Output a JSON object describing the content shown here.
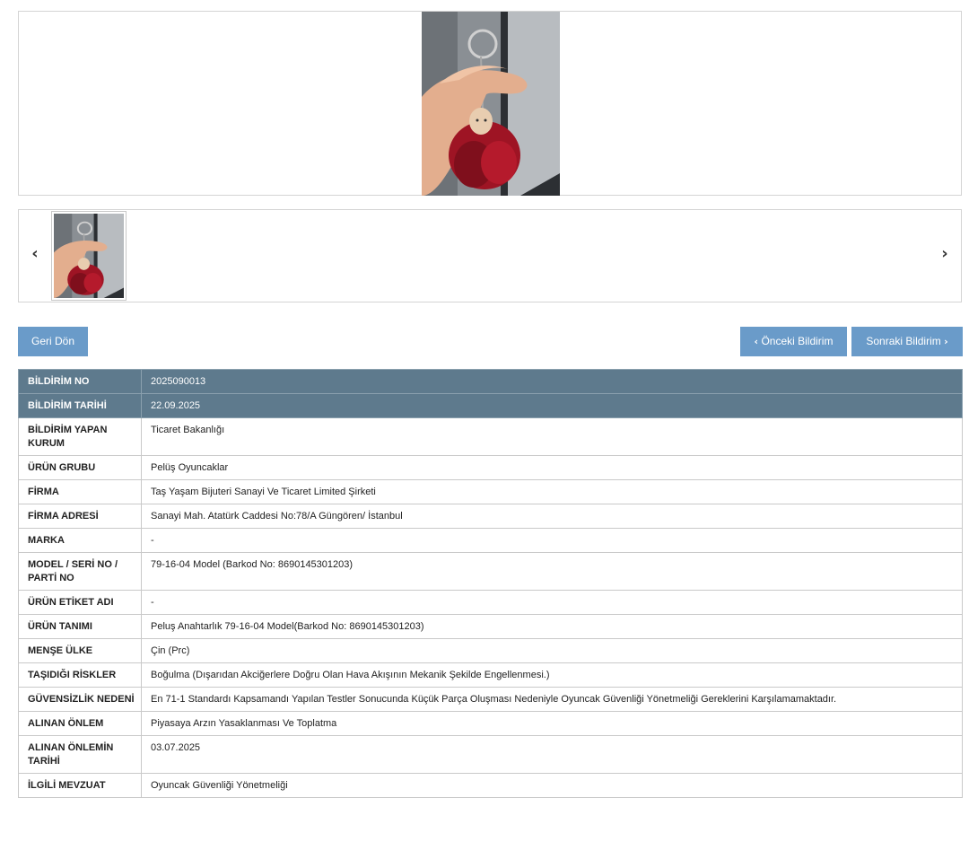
{
  "gallery": {
    "prev_arrow": "‹",
    "next_arrow": "›"
  },
  "buttons": {
    "back": "Geri Dön",
    "prev": "Önceki Bildirim",
    "next": "Sonraki Bildirim",
    "prev_chevron": "‹",
    "next_chevron": "›"
  },
  "details": [
    {
      "key": "BİLDİRİM NO",
      "value": "2025090013",
      "highlight": true
    },
    {
      "key": "BİLDİRİM TARİHİ",
      "value": "22.09.2025",
      "highlight": true
    },
    {
      "key": "BİLDİRİM YAPAN KURUM",
      "value": "Ticaret Bakanlığı"
    },
    {
      "key": "ÜRÜN GRUBU",
      "value": "Pelüş Oyuncaklar"
    },
    {
      "key": "FİRMA",
      "value": "Taş Yaşam Bijuteri Sanayi Ve Ticaret Limited Şirketi"
    },
    {
      "key": "FİRMA ADRESİ",
      "value": "Sanayi Mah. Atatürk Caddesi No:78/A Güngören/ İstanbul"
    },
    {
      "key": "MARKA",
      "value": "-"
    },
    {
      "key": "MODEL / SERİ NO / PARTİ NO",
      "value": "79-16-04 Model (Barkod No: 8690145301203)"
    },
    {
      "key": "ÜRÜN ETİKET ADI",
      "value": "-"
    },
    {
      "key": "ÜRÜN TANIMI",
      "value": "Peluş Anahtarlık 79-16-04 Model(Barkod No: 8690145301203)"
    },
    {
      "key": "MENŞE ÜLKE",
      "value": "Çin (Prc)"
    },
    {
      "key": "TAŞIDIĞI RİSKLER",
      "value": "Boğulma (Dışarıdan Akciğerlere Doğru Olan Hava Akışının Mekanik Şekilde Engellenmesi.)"
    },
    {
      "key": "GÜVENSİZLİK NEDENİ",
      "value": "En 71-1 Standardı Kapsamandı Yapılan Testler Sonucunda Küçük Parça Oluşması Nedeniyle Oyuncak Güvenliği Yönetmeliği Gereklerini Karşılamamaktadır."
    },
    {
      "key": "ALINAN ÖNLEM",
      "value": "Piyasaya Arzın Yasaklanması Ve Toplatma"
    },
    {
      "key": "ALINAN ÖNLEMİN TARİHİ",
      "value": "03.07.2025"
    },
    {
      "key": "İLGİLİ MEVZUAT",
      "value": "Oyuncak Güvenliği Yönetmeliği"
    }
  ]
}
